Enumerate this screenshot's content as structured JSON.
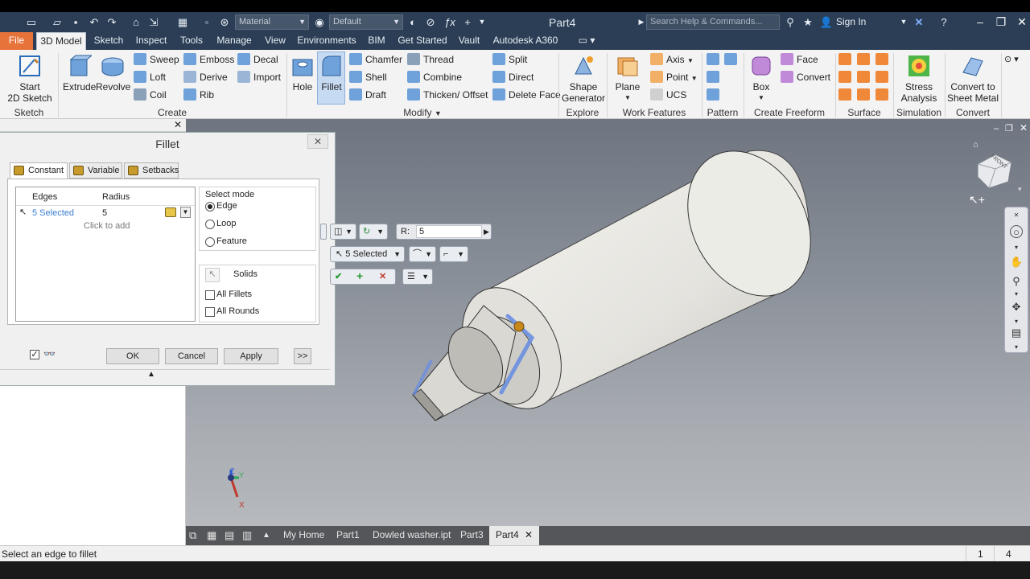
{
  "titlebar": {
    "material_combo": "Material",
    "appearance_combo": "Default",
    "document_title": "Part4",
    "search_placeholder": "Search Help & Commands...",
    "sign_in": "Sign In"
  },
  "menu_tabs": [
    "File",
    "3D Model",
    "Sketch",
    "Inspect",
    "Tools",
    "Manage",
    "View",
    "Environments",
    "BIM",
    "Get Started",
    "Vault",
    "Autodesk A360"
  ],
  "ribbon": {
    "sketch": {
      "start_line1": "Start",
      "start_line2": "2D Sketch",
      "group": "Sketch"
    },
    "create": {
      "extrude": "Extrude",
      "revolve": "Revolve",
      "sweep": "Sweep",
      "loft": "Loft",
      "coil": "Coil",
      "emboss": "Emboss",
      "derive": "Derive",
      "rib": "Rib",
      "decal": "Decal",
      "import": "Import",
      "group": "Create"
    },
    "modify": {
      "hole": "Hole",
      "fillet": "Fillet",
      "chamfer": "Chamfer",
      "shell": "Shell",
      "draft": "Draft",
      "thread": "Thread",
      "combine": "Combine",
      "thicken": "Thicken/ Offset",
      "split": "Split",
      "direct": "Direct",
      "delete_face": "Delete Face",
      "group": "Modify"
    },
    "explore": {
      "shape_line1": "Shape",
      "shape_line2": "Generator",
      "group": "Explore"
    },
    "work_features": {
      "plane": "Plane",
      "axis": "Axis",
      "point": "Point",
      "ucs": "UCS",
      "group": "Work Features"
    },
    "pattern": {
      "group": "Pattern"
    },
    "freeform": {
      "box": "Box",
      "face": "Face",
      "convert": "Convert",
      "group": "Create Freeform"
    },
    "surface": {
      "group": "Surface"
    },
    "simulation": {
      "stress_line1": "Stress",
      "stress_line2": "Analysis",
      "group": "Simulation"
    },
    "convert": {
      "sheet_line1": "Convert to",
      "sheet_line2": "Sheet Metal",
      "group": "Convert"
    }
  },
  "dialog": {
    "title": "Fillet",
    "tabs": [
      "Constant",
      "Variable",
      "Setbacks"
    ],
    "col_edges": "Edges",
    "col_radius": "Radius",
    "row_edges": "5 Selected",
    "row_radius": "5",
    "click_to_add": "Click to add",
    "select_mode_label": "Select mode",
    "mode_edge": "Edge",
    "mode_loop": "Loop",
    "mode_feature": "Feature",
    "selected_mode": "Edge",
    "solids": "Solids",
    "all_fillets": "All Fillets",
    "all_rounds": "All Rounds",
    "ok": "OK",
    "cancel": "Cancel",
    "apply": "Apply",
    "more": ">>"
  },
  "minitoolbar": {
    "radius_label": "R:",
    "radius_value": "5",
    "selection": "5 Selected"
  },
  "doc_tabs": [
    "My Home",
    "Part1",
    "Dowled washer.ipt",
    "Part3",
    "Part4"
  ],
  "status": {
    "prompt": "Select an edge to fillet",
    "count1": "1",
    "count2": "4"
  },
  "viewcube": {
    "front_label": "FRONT"
  },
  "axes": {
    "x": "X",
    "y": "Y",
    "z": "Z"
  }
}
